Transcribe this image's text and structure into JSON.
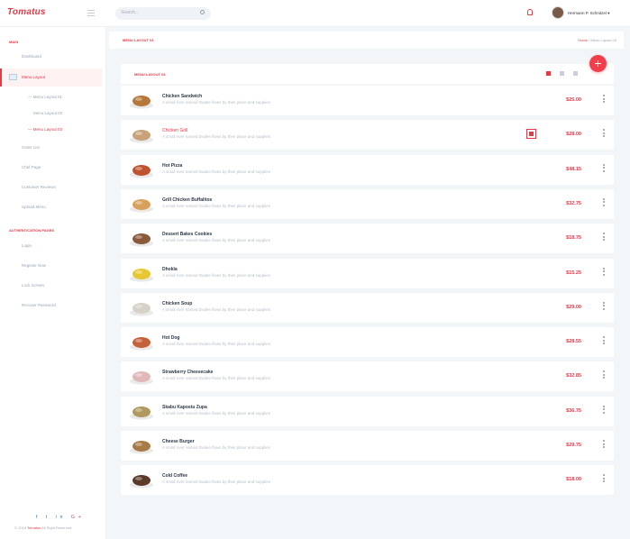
{
  "app": {
    "logo": "Tomatus"
  },
  "search": {
    "placeholder": "Search..."
  },
  "user": {
    "name": "Hermann P. Schnitzel"
  },
  "sidebar": {
    "main_heading": "MAIN",
    "dashboard": "Dashboard",
    "menu_layout": "Menu Layout",
    "submenu": [
      "Menu Layout 01",
      "Menu Layout 02",
      "Menu Layout 03"
    ],
    "items": [
      "Order List",
      "Chef Page",
      "Customer Reviews",
      "Upload Menu"
    ],
    "auth_heading": "AUTHENTICATION PAGES",
    "auth_items": [
      "Login",
      "Register Now",
      "Lock Screen",
      "Recover Password"
    ],
    "social": [
      "f",
      "t",
      "in",
      "G+"
    ],
    "copyright_prefix": "© 2018",
    "copyright_brand": "Tomatus",
    "copyright_suffix": "All Right Reserved."
  },
  "page": {
    "title": "MENU LAYOUT 03",
    "breadcrumb_home": "Home",
    "breadcrumb_sep": "/",
    "breadcrumb_current": "Menu Layout 03",
    "card_title": "MENU LAYOUT 03",
    "add_label": "+"
  },
  "menu_items": [
    {
      "name": "Chicken Sandwich",
      "desc": "A small river named Duden flows by their place and supplies",
      "price": "$25.00",
      "icon": "sandwich-image"
    },
    {
      "name": "Chicken Grill",
      "desc": "A small river named Duden flows by their place and supplies",
      "price": "$28.00",
      "icon": "grill-image"
    },
    {
      "name": "Hot Pizza",
      "desc": "A small river named Duden flows by their place and supplies",
      "price": "$48.15",
      "icon": "pizza-image"
    },
    {
      "name": "Grill Chicken Buffalitos",
      "desc": "A small river named Duden flows by their place and supplies",
      "price": "$32.75",
      "icon": "buffalitos-image"
    },
    {
      "name": "Dessert Bakes Cookies",
      "desc": "A small river named Duden flows by their place and supplies",
      "price": "$18.75",
      "icon": "cookies-image"
    },
    {
      "name": "Dhokla",
      "desc": "A small river named Duden flows by their place and supplies",
      "price": "$15.25",
      "icon": "dhokla-image"
    },
    {
      "name": "Chicken Soup",
      "desc": "A small river named Duden flows by their place and supplies",
      "price": "$29.00",
      "icon": "soup-image"
    },
    {
      "name": "Hot Dog",
      "desc": "A small river named Duden flows by their place and supplies",
      "price": "$28.55",
      "icon": "hotdog-image"
    },
    {
      "name": "Strawberry Cheesecake",
      "desc": "A small river named Duden flows by their place and supplies",
      "price": "$32.85",
      "icon": "cheesecake-image"
    },
    {
      "name": "Skabu Kapostu Zupa",
      "desc": "A small river named Duden flows by their place and supplies",
      "price": "$36.75",
      "icon": "zupa-image"
    },
    {
      "name": "Cheese Burger",
      "desc": "A small river named Duden flows by their place and supplies",
      "price": "$29.75",
      "icon": "burger-image"
    },
    {
      "name": "Cold Coffee",
      "desc": "A small river named Duden flows by their place and supplies",
      "price": "$18.00",
      "icon": "coffee-image"
    }
  ],
  "colors": {
    "accent": "#e53946",
    "background": "#f3f6f9",
    "muted": "#99a5b5"
  }
}
